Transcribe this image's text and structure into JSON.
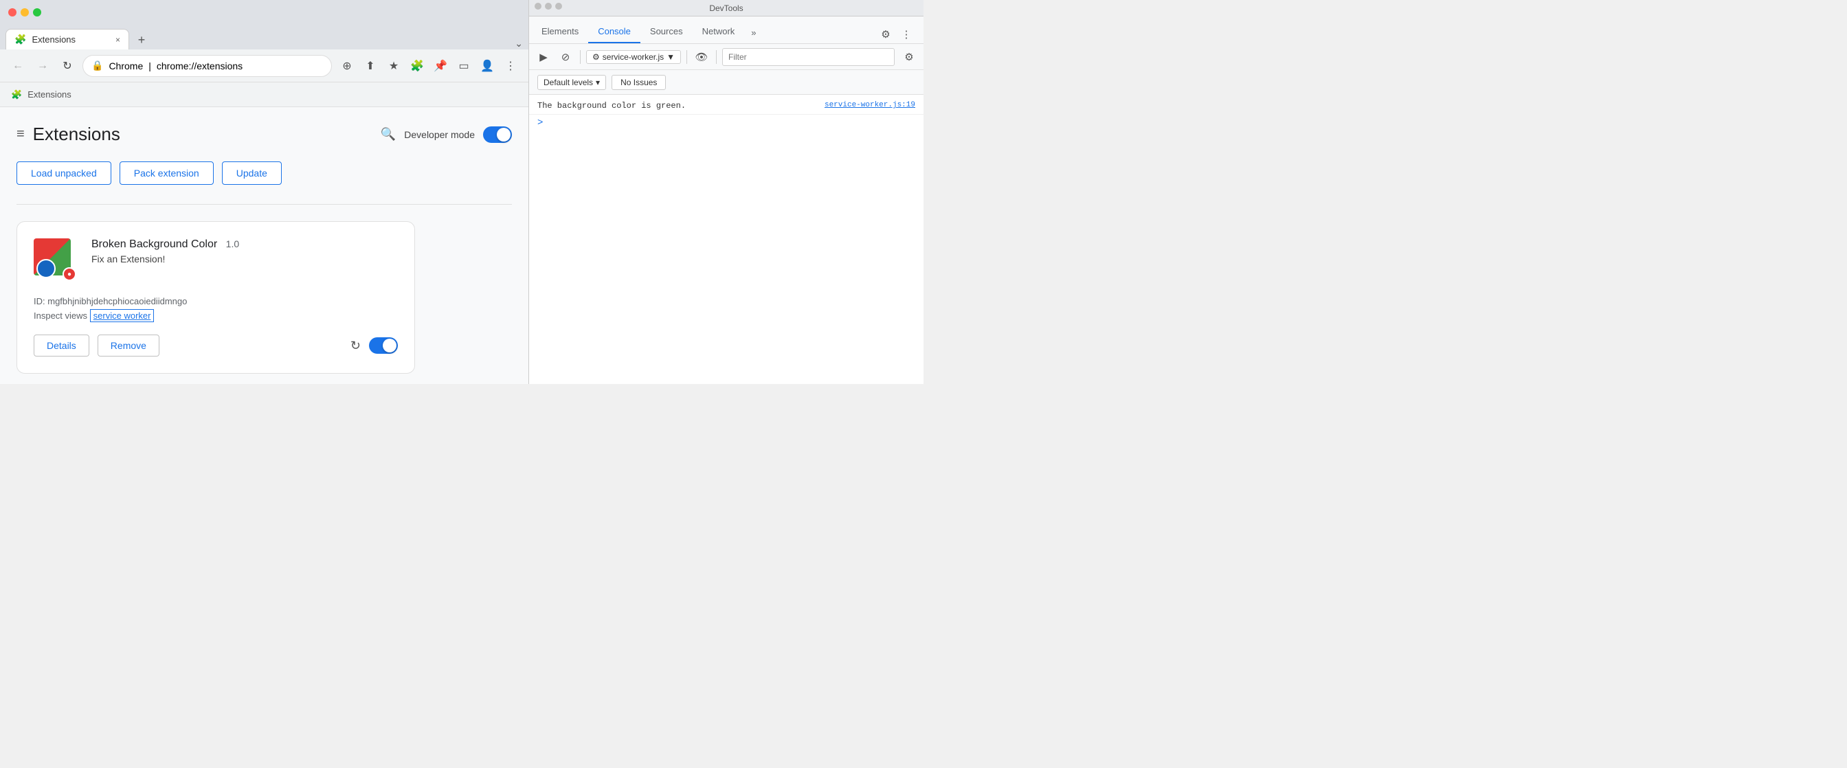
{
  "browser": {
    "traffic_lights": [
      "red",
      "yellow",
      "green"
    ],
    "tab": {
      "icon": "🧩",
      "label": "Extensions",
      "close": "×"
    },
    "tab_new": "+",
    "tab_menu": "⌄",
    "nav": {
      "back": "←",
      "forward": "→",
      "refresh": "↻"
    },
    "url": {
      "scheme_icon": "🔒",
      "scheme": "Chrome",
      "separator": "|",
      "address": "chrome://extensions"
    },
    "toolbar": {
      "zoom_icon": "⊕",
      "share_icon": "⬆",
      "star_icon": "★",
      "puzzle_icon": "🧩",
      "pin_icon": "📌",
      "sidebar_icon": "▭",
      "profile_icon": "👤",
      "menu_icon": "⋮"
    },
    "breadcrumb": {
      "icon": "🧩",
      "label": "Extensions"
    }
  },
  "extensions_page": {
    "hamburger": "≡",
    "title": "Extensions",
    "search_icon": "🔍",
    "developer_mode_label": "Developer mode",
    "toggle_on": true,
    "buttons": [
      {
        "label": "Load unpacked"
      },
      {
        "label": "Pack extension"
      },
      {
        "label": "Update"
      }
    ],
    "extension_card": {
      "name": "Broken Background Color",
      "version": "1.0",
      "description": "Fix an Extension!",
      "id_label": "ID:",
      "id_value": "mgfbhjnibhjdehcphiocaoiediidmngo",
      "inspect_label": "Inspect views",
      "service_worker_link": "service worker",
      "details_btn": "Details",
      "remove_btn": "Remove",
      "reload_icon": "↻",
      "enabled": true
    }
  },
  "devtools": {
    "title": "DevTools",
    "traffic_lights": [
      "gray",
      "gray",
      "gray"
    ],
    "tabs": [
      {
        "label": "Elements",
        "active": false
      },
      {
        "label": "Console",
        "active": true
      },
      {
        "label": "Sources",
        "active": false
      },
      {
        "label": "Network",
        "active": false
      }
    ],
    "tab_more": "»",
    "toolbar_icons": {
      "settings": "⚙",
      "more": "⋮"
    },
    "console_toolbar": {
      "play_icon": "▶",
      "no_entry_icon": "⊘",
      "service_worker": "service-worker.js",
      "sw_arrow": "▼",
      "eye_icon": "👁",
      "filter_placeholder": "Filter",
      "gear_icon": "⚙"
    },
    "levels": {
      "label": "Default levels",
      "arrow": "▾",
      "no_issues": "No Issues"
    },
    "console_lines": [
      {
        "message": "The background color is green.",
        "source": "service-worker.js:19"
      }
    ],
    "prompt_arrow": ">"
  }
}
